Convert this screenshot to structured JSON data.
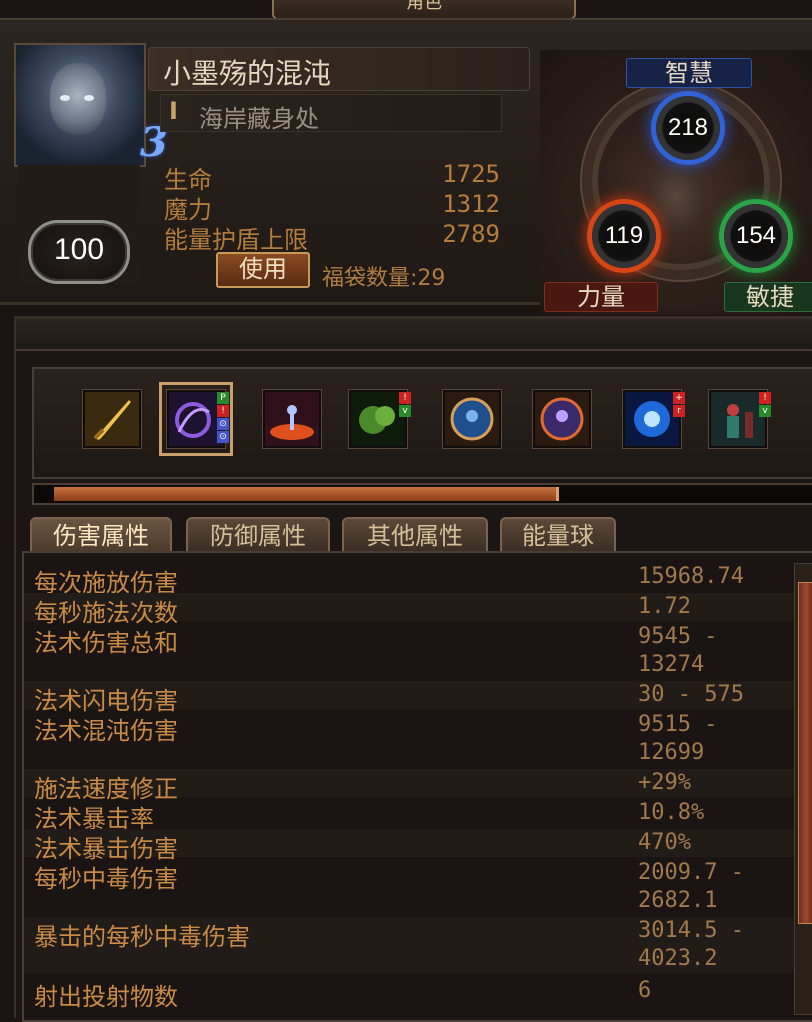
{
  "window": {
    "title": "角色"
  },
  "character": {
    "name": "小墨殇的混沌",
    "location_rank": "I",
    "location": "海岸藏身处",
    "level": "100",
    "rank_badge": "3",
    "life_label": "生命",
    "life_value": "1725",
    "mana_label": "魔力",
    "mana_value": "1312",
    "es_label": "能量护盾上限",
    "es_value": "2789",
    "use_button": "使用",
    "bag_count": "福袋数量:29"
  },
  "attributes": {
    "intelligence_label": "智慧",
    "intelligence_value": "218",
    "strength_label": "力量",
    "strength_value": "119",
    "dexterity_label": "敏捷",
    "dexterity_value": "154",
    "colors": {
      "intelligence": "#2f63d6",
      "strength": "#d54515",
      "dexterity": "#2aa245"
    }
  },
  "skills": [
    {
      "icon": "golden-sword-skill-icon",
      "selected": false
    },
    {
      "icon": "chaos-spell-skill-icon",
      "selected": true,
      "gems": [
        "P",
        "!",
        "⊙",
        "⊙"
      ]
    },
    {
      "icon": "fire-nova-skill-icon",
      "selected": false
    },
    {
      "icon": "poison-cloud-skill-icon",
      "selected": false,
      "gems": [
        "!",
        "v"
      ]
    },
    {
      "icon": "blue-aura-skill-icon",
      "selected": false
    },
    {
      "icon": "red-aura-skill-icon",
      "selected": false
    },
    {
      "icon": "lightning-orb-skill-icon",
      "selected": false,
      "gems": [
        "+",
        "r"
      ]
    },
    {
      "icon": "summon-skill-icon",
      "selected": false,
      "gems": [
        "!",
        "v"
      ]
    }
  ],
  "experience_progress": 0.66,
  "tabs": [
    "伤害属性",
    "防御属性",
    "其他属性",
    "能量球"
  ],
  "stats": [
    {
      "label": "每次施放伤害",
      "value": "15968.74"
    },
    {
      "label": "每秒施法次数",
      "value": "1.72"
    },
    {
      "label": "法术伤害总和",
      "value": "9545 -\n13274"
    },
    {
      "label": "法术闪电伤害",
      "value": "30 - 575"
    },
    {
      "label": "法术混沌伤害",
      "value": "9515 -\n12699"
    },
    {
      "label": "施法速度修正",
      "value": "+29%"
    },
    {
      "label": "法术暴击率",
      "value": "10.8%"
    },
    {
      "label": "法术暴击伤害",
      "value": "470%"
    },
    {
      "label": "每秒中毒伤害",
      "value": "2009.7 -\n2682.1"
    },
    {
      "label": "暴击的每秒中毒伤害",
      "value": "3014.5 -\n4023.2"
    },
    {
      "label": "射出投射物数",
      "value": "6"
    }
  ]
}
